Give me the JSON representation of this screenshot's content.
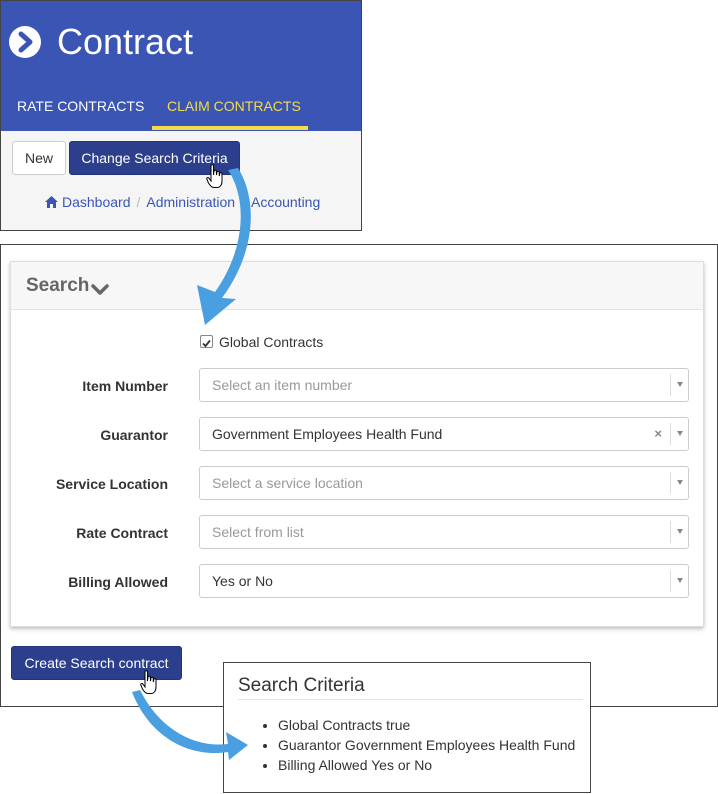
{
  "header": {
    "title": "Contract",
    "tabs": [
      {
        "label": "RATE CONTRACTS",
        "active": false
      },
      {
        "label": "CLAIM CONTRACTS",
        "active": true
      }
    ]
  },
  "toolbar": {
    "new_label": "New",
    "change_criteria_label": "Change Search Criteria"
  },
  "breadcrumb": [
    "Dashboard",
    "Administration",
    "Accounting"
  ],
  "search": {
    "title": "Search",
    "global_contracts": {
      "label": "Global Contracts",
      "checked": true
    },
    "fields": [
      {
        "label": "Item Number",
        "value": "Select an item number",
        "placeholder": true
      },
      {
        "label": "Guarantor",
        "value": "Government Employees Health Fund",
        "placeholder": false,
        "clear": "×"
      },
      {
        "label": "Service Location",
        "value": "Select a service location",
        "placeholder": true
      },
      {
        "label": "Rate Contract",
        "value": "Select from list",
        "placeholder": true
      },
      {
        "label": "Billing Allowed",
        "value": "Yes or No",
        "placeholder": false
      }
    ],
    "create_label": "Create Search contract"
  },
  "criteria": {
    "title": "Search Criteria",
    "items": [
      "Global Contracts true",
      "Guarantor Government Employees Health Fund",
      "Billing Allowed Yes or No"
    ]
  },
  "colors": {
    "header_bg": "#3a55b4",
    "tab_active": "#f3dc4a",
    "primary_button": "#2b3f8c",
    "arrow": "#4a9fe0"
  },
  "icons": {
    "title": "chevron-circle-right-icon",
    "breadcrumb_home": "home-icon",
    "collapse": "chevron-down-icon",
    "cursor": "hand-pointer-icon"
  }
}
